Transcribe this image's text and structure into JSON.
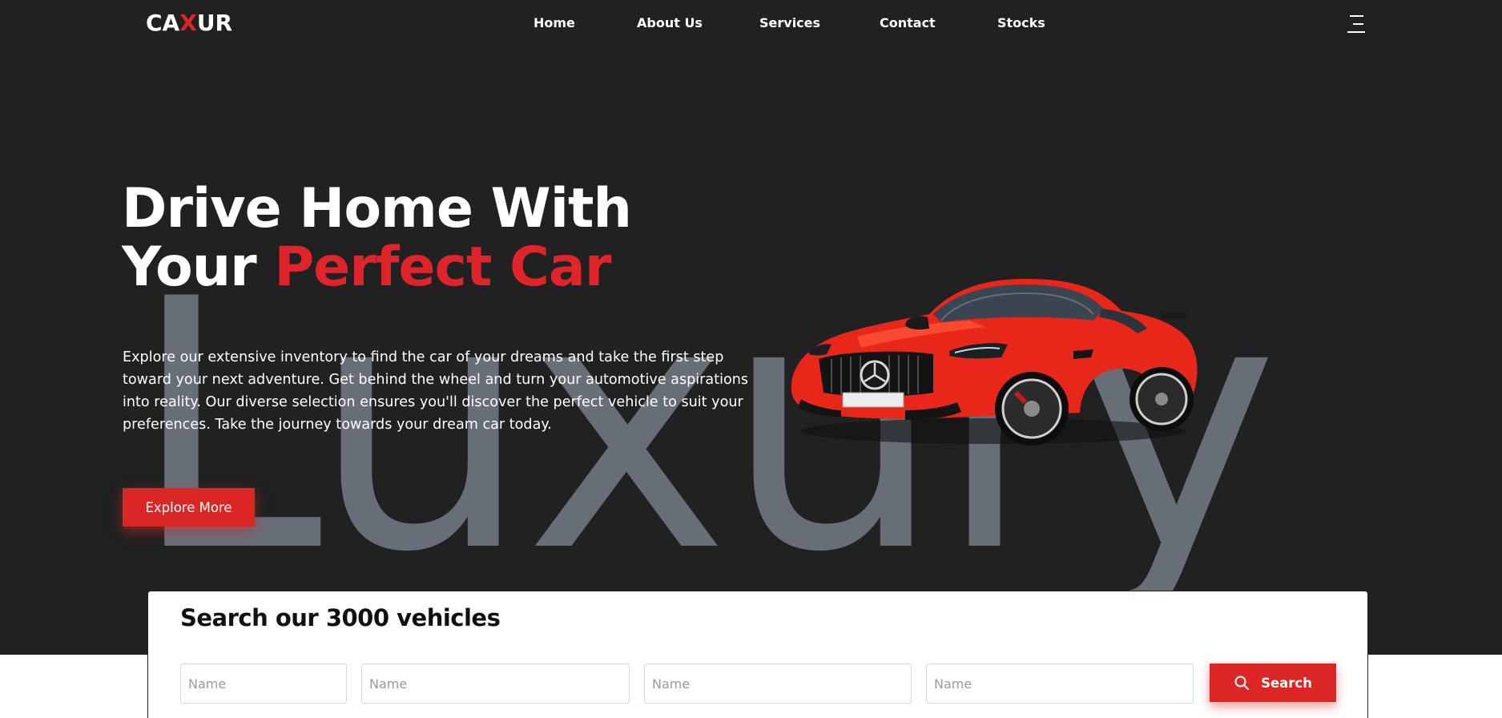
{
  "nav": {
    "logo": {
      "left": "CA",
      "accent": "X",
      "right": "UR"
    },
    "links": [
      "Home",
      "About Us",
      "Services",
      "Contact",
      "Stocks"
    ]
  },
  "hero": {
    "watermark": "Luxury",
    "headline_line1": "Drive Home With",
    "headline_line2_white": "Your ",
    "headline_line2_red": "Perfect Car",
    "description": "Explore our extensive inventory to find the car of your dreams and take the first step toward your next adventure. Get behind the wheel and turn your automotive aspirations into reality. Our diverse selection ensures you'll discover the perfect vehicle to suit your preferences. Take the journey towards your dream car today.",
    "cta_label": "Explore More"
  },
  "search": {
    "title": "Search our 3000 vehicles",
    "fields": [
      {
        "placeholder": "Name"
      },
      {
        "placeholder": "Name"
      },
      {
        "placeholder": "Name"
      },
      {
        "placeholder": "Name"
      }
    ],
    "button_label": "Search",
    "button_icon": "search-icon"
  },
  "colors": {
    "hero_bg": "#212122",
    "accent": "#e0242b",
    "watermark": "#686e78"
  }
}
